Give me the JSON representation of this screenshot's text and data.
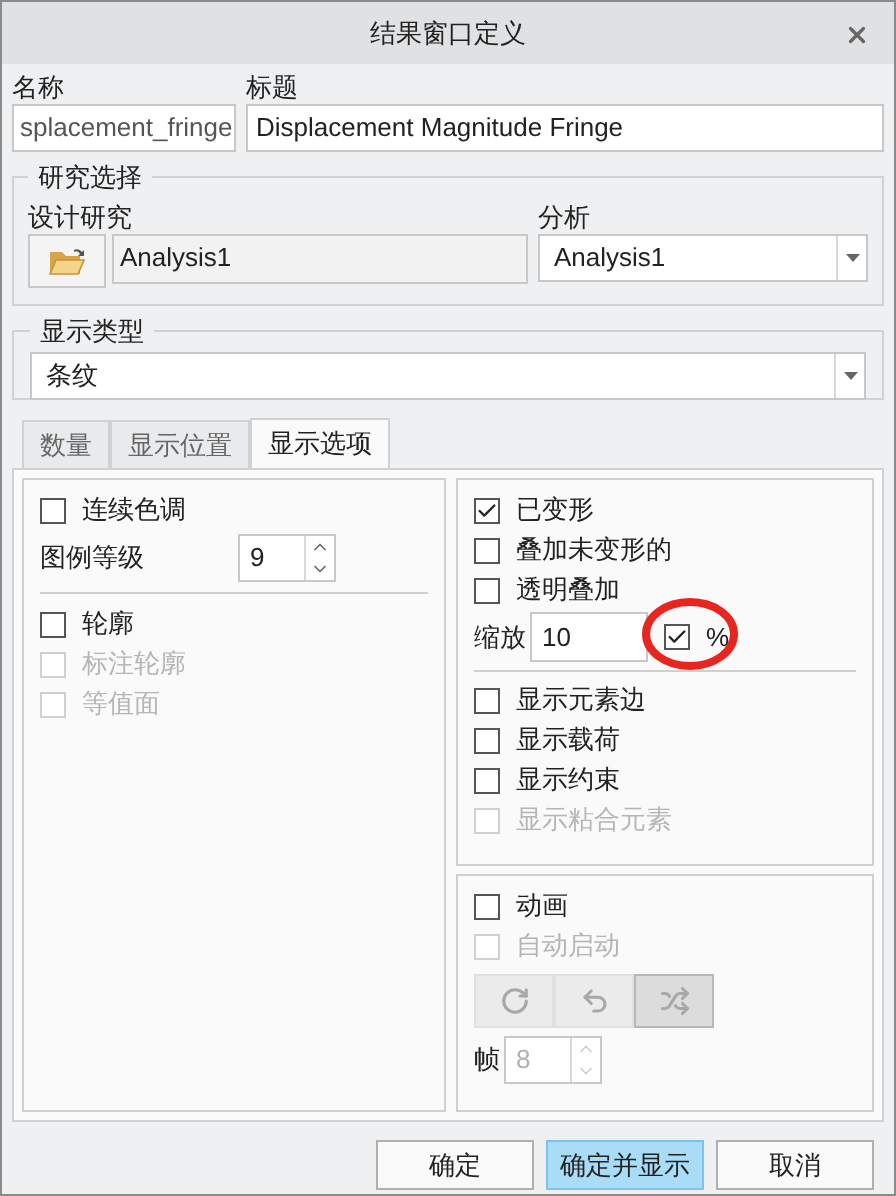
{
  "window": {
    "title": "结果窗口定义"
  },
  "name": {
    "label": "名称",
    "value": "splacement_fringe"
  },
  "caption": {
    "label": "标题",
    "value": "Displacement Magnitude Fringe"
  },
  "study": {
    "legend": "研究选择",
    "design_label": "设计研究",
    "design_value": "Analysis1",
    "analysis_label": "分析",
    "analysis_value": "Analysis1"
  },
  "display_type": {
    "legend": "显示类型",
    "value": "条纹"
  },
  "tabs": [
    {
      "label": "数量",
      "selected": false
    },
    {
      "label": "显示位置",
      "selected": false
    },
    {
      "label": "显示选项",
      "selected": true
    }
  ],
  "tone": {
    "label": "连续色调",
    "checked": false,
    "disabled": false
  },
  "legend_levels": {
    "label": "图例等级",
    "value": "9"
  },
  "contour_items": [
    {
      "label": "轮廓",
      "checked": false,
      "disabled": false
    },
    {
      "label": "标注轮廓",
      "checked": false,
      "disabled": true
    },
    {
      "label": "等值面",
      "checked": false,
      "disabled": true
    }
  ],
  "deformed_items": [
    {
      "label": "已变形",
      "checked": true,
      "disabled": false
    },
    {
      "label": "叠加未变形的",
      "checked": false,
      "disabled": false
    },
    {
      "label": "透明叠加",
      "checked": false,
      "disabled": false
    }
  ],
  "scale": {
    "label": "缩放",
    "value": "10",
    "percent_checked": true,
    "percent_label": "%",
    "highlighted": true
  },
  "element_items": [
    {
      "label": "显示元素边",
      "checked": false,
      "disabled": false
    },
    {
      "label": "显示载荷",
      "checked": false,
      "disabled": false
    },
    {
      "label": "显示约束",
      "checked": false,
      "disabled": false
    },
    {
      "label": "显示粘合元素",
      "checked": false,
      "disabled": true
    }
  ],
  "animation_items": [
    {
      "label": "动画",
      "checked": false,
      "disabled": false
    },
    {
      "label": "自动启动",
      "checked": false,
      "disabled": true
    }
  ],
  "playback_buttons": [
    {
      "kind": "repeat",
      "selected": false
    },
    {
      "kind": "reverse",
      "selected": false
    },
    {
      "kind": "shuffle",
      "selected": true
    }
  ],
  "frames": {
    "label": "帧",
    "value": "8",
    "disabled": true
  },
  "buttons": [
    {
      "label": "确定",
      "selected": false
    },
    {
      "label": "确定并显示",
      "selected": true
    },
    {
      "label": "取消",
      "selected": false
    }
  ]
}
